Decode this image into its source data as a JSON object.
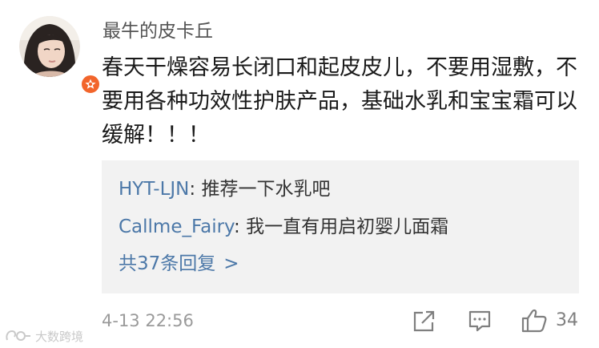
{
  "comment": {
    "username": "最牛的皮卡丘",
    "text": "春天干燥容易长闭口和起皮皮儿，不要用湿敷，不要用各种功效性护肤产品，基础水乳和宝宝霜可以缓解！！！",
    "timestamp": "4-13 22:56",
    "like_count": "34"
  },
  "replies": [
    {
      "user": "HYT-LJN",
      "separator": ": ",
      "text": "推荐一下水乳吧"
    },
    {
      "user": "Callme_Fairy",
      "separator": ": ",
      "text": "我一直有用启初婴儿面霜"
    }
  ],
  "more_replies": {
    "label": "共37条回复",
    "chevron": ">"
  },
  "watermark": {
    "text": "大数跨境"
  },
  "icons": {
    "badge": "verified-badge-icon",
    "share": "share-icon",
    "reply": "comment-icon",
    "like": "thumbs-up-icon"
  },
  "colors": {
    "link": "#4c78a8",
    "badge": "#f2652b",
    "reply_bg": "#f2f2f2",
    "meta": "#9a9a9a"
  }
}
